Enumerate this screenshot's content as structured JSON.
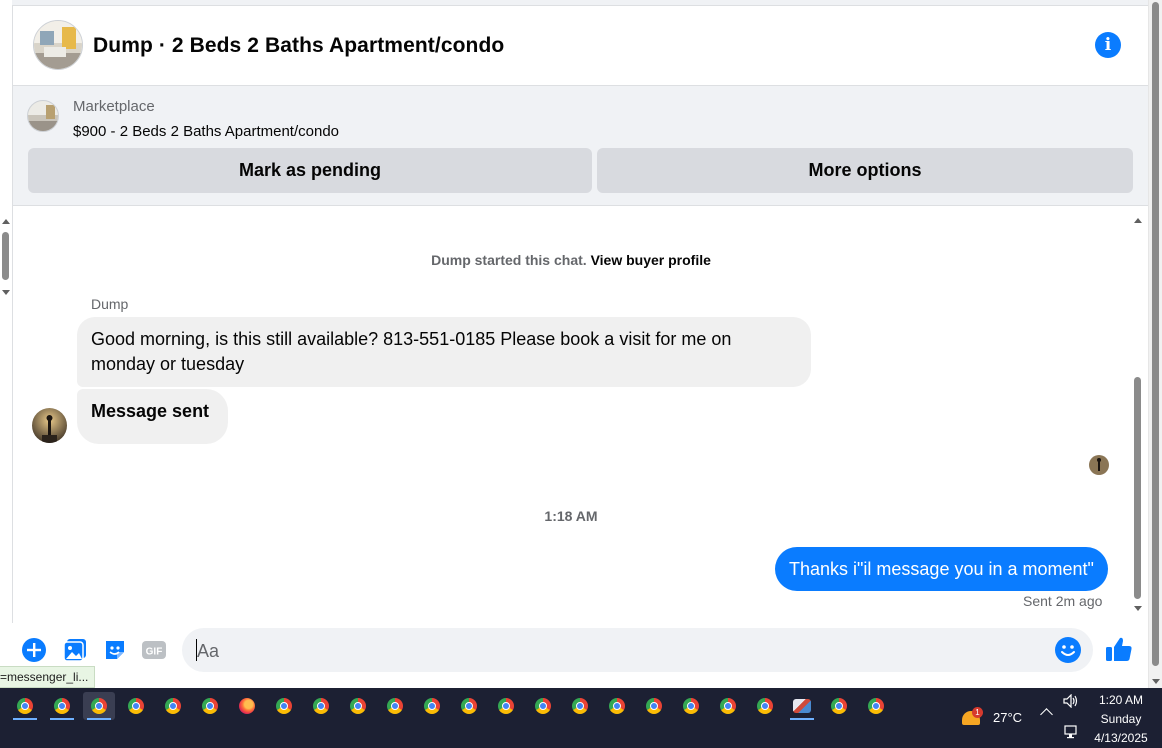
{
  "header": {
    "title": "Dump · 2 Beds 2 Baths Apartment/condo",
    "info_icon": "info-icon"
  },
  "listing": {
    "label": "Marketplace",
    "title": "$900 - 2 Beds 2 Baths Apartment/condo",
    "mark_pending": "Mark as pending",
    "more_options": "More options"
  },
  "chat": {
    "started_text": "Dump started this chat.",
    "view_profile": "View buyer profile",
    "sender_name": "Dump",
    "incoming_message": "Good morning, is this still available? 813-551-0185 Please book a visit for me on monday or tuesday",
    "incoming_message_2": "Message sent",
    "timestamp": "1:18 AM",
    "outgoing_message": "Thanks i\"il message you in a moment\"",
    "sent_status": "Sent 2m ago"
  },
  "composer": {
    "placeholder": "Aa",
    "icons": [
      "plus-circle-icon",
      "photo-icon",
      "sticker-icon",
      "gif-icon",
      "emoji-icon",
      "thumbs-up-icon"
    ],
    "gif_label": "GIF"
  },
  "statusbar": {
    "url": "=messenger_li..."
  },
  "taskbar": {
    "weather_badge": "1",
    "temperature": "27°C",
    "time": "1:20 AM",
    "day": "Sunday",
    "date": "4/13/2025"
  },
  "colors": {
    "accent": "#0a7cff",
    "outgoing_bubble": "#0a7cff",
    "incoming_bubble": "#f0f0f0",
    "button_bg": "#d8dadf",
    "taskbar_bg": "#1c2033"
  }
}
